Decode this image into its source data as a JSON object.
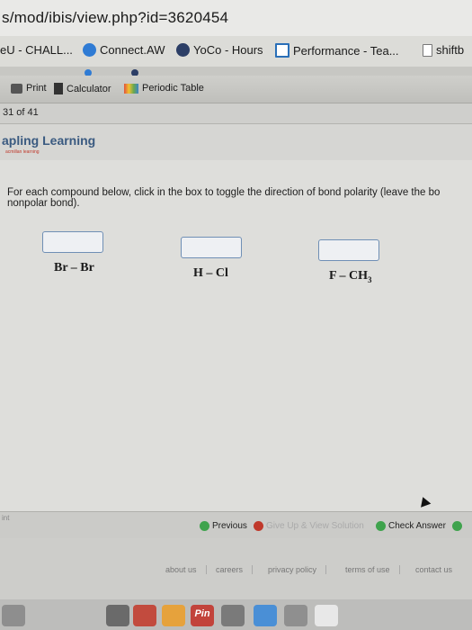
{
  "browser": {
    "url_text": "s/mod/ibis/view.php?id=3620454"
  },
  "bookmarks": [
    {
      "label": "eU - CHALL...",
      "icon": "page-icon"
    },
    {
      "label": "Connect.AW",
      "icon": "connect-icon"
    },
    {
      "label": "YoCo - Hours",
      "icon": "yoco-icon"
    },
    {
      "label": "Performance - Tea...",
      "icon": "performance-icon"
    },
    {
      "label": "shiftb",
      "icon": "document-icon"
    }
  ],
  "toolbar": {
    "print_label": "Print",
    "calculator_label": "Calculator",
    "periodic_label": "Periodic Table"
  },
  "page_count": "31 of 41",
  "brand": {
    "name": "apling Learning",
    "sub": "acmillan learning"
  },
  "question": {
    "instruction_line1": "For each compound below, click in the box to toggle the direction of bond polarity (leave the bo",
    "instruction_line2": "nonpolar bond).",
    "compounds": [
      {
        "formula_main": "Br – Br",
        "formula_sub": ""
      },
      {
        "formula_main": "H – Cl",
        "formula_sub": ""
      },
      {
        "formula_main": "F – CH",
        "formula_sub": "3"
      }
    ]
  },
  "actions": {
    "hint": "int",
    "previous_label": "Previous",
    "giveup_label": "Give Up & View Solution",
    "check_label": "Check Answer"
  },
  "footer": {
    "links": [
      "about us",
      "careers",
      "privacy policy",
      "terms of use",
      "contact us"
    ]
  },
  "dock": {
    "pin_label": "Pin"
  },
  "colors": {
    "box_border": "#6f8fb5",
    "brand": "#3a5a80",
    "check_green": "#3fa34d",
    "giveup_red": "#c0392b"
  }
}
